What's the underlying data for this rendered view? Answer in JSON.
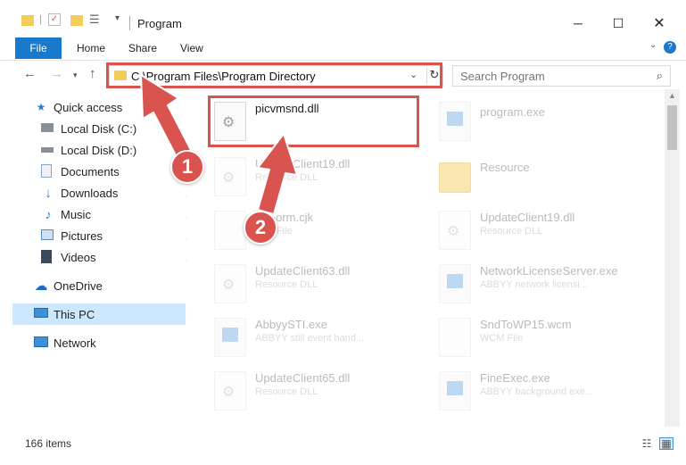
{
  "window": {
    "title": "Program"
  },
  "ribbon": {
    "file": "File",
    "home": "Home",
    "share": "Share",
    "view": "View"
  },
  "address": {
    "path": "C:\\Program Files\\Program Directory"
  },
  "search": {
    "placeholder": "Search Program"
  },
  "sidebar": {
    "items": [
      {
        "label": "Quick access",
        "icon": "star-icon"
      },
      {
        "label": "Local Disk (C:)",
        "icon": "drive-icon"
      },
      {
        "label": "Local Disk (D:)",
        "icon": "drive-icon"
      },
      {
        "label": "Documents",
        "icon": "documents-icon"
      },
      {
        "label": "Downloads",
        "icon": "download-icon"
      },
      {
        "label": "Music",
        "icon": "music-icon"
      },
      {
        "label": "Pictures",
        "icon": "pictures-icon"
      },
      {
        "label": "Videos",
        "icon": "videos-icon"
      },
      {
        "label": "OneDrive",
        "icon": "cloud-icon"
      },
      {
        "label": "This PC",
        "icon": "computer-icon"
      },
      {
        "label": "Network",
        "icon": "network-icon"
      }
    ]
  },
  "files": {
    "items": [
      {
        "name": "picvmsnd.dll",
        "sub": ""
      },
      {
        "name": "program.exe",
        "sub": ""
      },
      {
        "name": "UpdateClient19.dll",
        "sub": "Resource DLL"
      },
      {
        "name": "Resource",
        "sub": ""
      },
      {
        "name": "FbForm.cjk",
        "sub": "CJK File"
      },
      {
        "name": "UpdateClient19.dll",
        "sub": "Resource DLL"
      },
      {
        "name": "UpdateClient63.dll",
        "sub": "Resource DLL"
      },
      {
        "name": "NetworkLicenseServer.exe",
        "sub": "ABBYY network licensi..."
      },
      {
        "name": "AbbyySTI.exe",
        "sub": "ABBYY still event hand..."
      },
      {
        "name": "SndToWP15.wcm",
        "sub": "WCM File"
      },
      {
        "name": "UpdateClient65.dll",
        "sub": "Resource DLL"
      },
      {
        "name": "FineExec.exe",
        "sub": "ABBYY background exe..."
      }
    ]
  },
  "status": {
    "items": "166 items"
  },
  "annotations": {
    "step1": "1",
    "step2": "2"
  },
  "colors": {
    "accent": "#1979ca",
    "highlight": "#d9534f",
    "selected": "#cce8ff"
  }
}
